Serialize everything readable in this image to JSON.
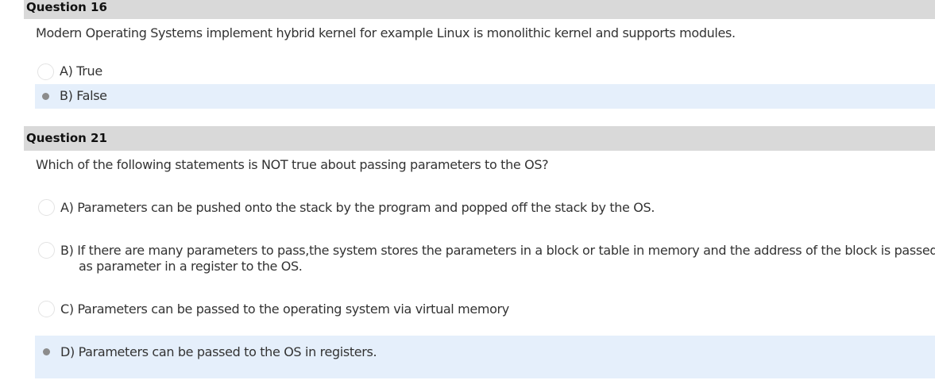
{
  "question16": {
    "title": "Question 16",
    "text": "Modern Operating Systems implement hybrid kernel for example Linux is monolithic kernel and supports modules.",
    "answers": [
      {
        "label": "A) True",
        "selected": false
      },
      {
        "label": "B) False",
        "selected": true
      }
    ]
  },
  "question21": {
    "title": "Question 21",
    "text": "Which of the following statements is NOT true about passing parameters to the OS?",
    "answers": [
      {
        "label": "A) Parameters can be pushed onto the stack by the program and popped off the stack by the OS.",
        "selected": false
      },
      {
        "label": "B) If there are many parameters to pass,the system stores the parameters in a block or table in memory and the address of the block is passed",
        "label_cont": "as parameter in a register to the OS.",
        "selected": false
      },
      {
        "label": "C) Parameters can be passed to the operating system via virtual memory",
        "selected": false
      },
      {
        "label": "D) Parameters can be passed to the OS in registers.",
        "selected": true
      }
    ]
  },
  "colors": {
    "header_bg": "#d9d9d9",
    "selected_bg": "#e5effb",
    "radio_dot": "#8c8c8c"
  }
}
